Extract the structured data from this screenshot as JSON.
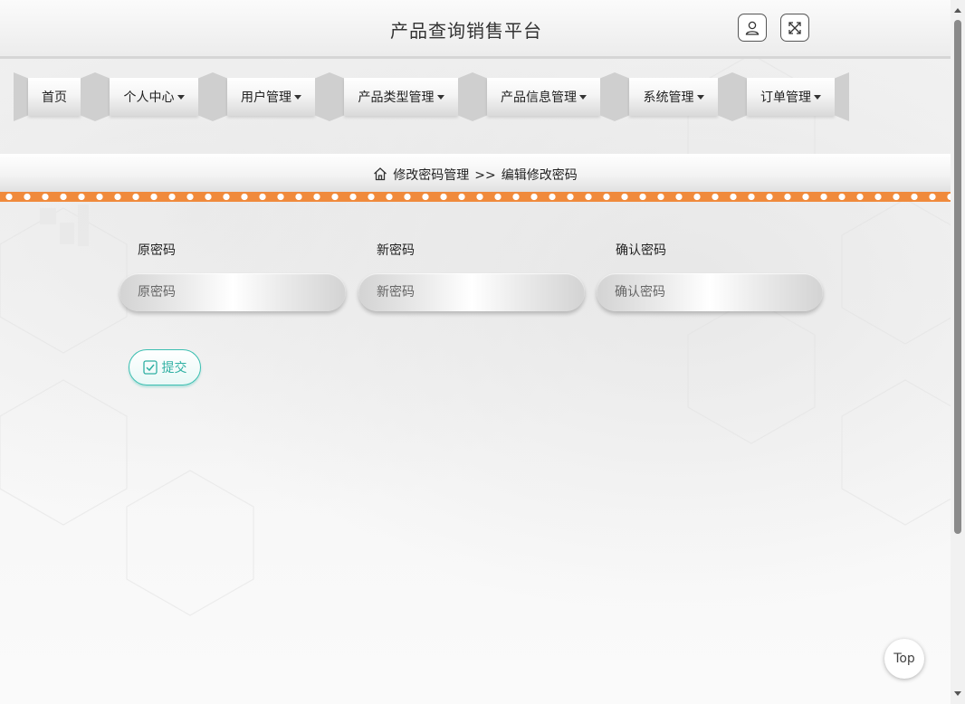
{
  "header": {
    "title": "产品查询销售平台",
    "user_button_icon": "user-icon",
    "fullscreen_button_icon": "fullscreen-icon"
  },
  "nav": {
    "items": [
      {
        "label": "首页",
        "dropdown": false
      },
      {
        "label": "个人中心",
        "dropdown": true
      },
      {
        "label": "用户管理",
        "dropdown": true
      },
      {
        "label": "产品类型管理",
        "dropdown": true
      },
      {
        "label": "产品信息管理",
        "dropdown": true
      },
      {
        "label": "系统管理",
        "dropdown": true
      },
      {
        "label": "订单管理",
        "dropdown": true
      }
    ]
  },
  "breadcrumb": {
    "icon": "home-icon",
    "parent": "修改密码管理",
    "separator": ">>",
    "current": "编辑修改密码"
  },
  "form": {
    "old_password": {
      "label": "原密码",
      "value": "",
      "placeholder": "原密码"
    },
    "new_password": {
      "label": "新密码",
      "value": "",
      "placeholder": "新密码"
    },
    "confirm_password": {
      "label": "确认密码",
      "value": "",
      "placeholder": "确认密码"
    },
    "submit_label": "提交",
    "submit_icon": "checkbox-icon"
  },
  "top_button_label": "Top",
  "colors": {
    "accent_orange": "#f08a3c",
    "submit_teal": "#2fb0a3",
    "nav_hex_gray": "#cfcfcf"
  }
}
